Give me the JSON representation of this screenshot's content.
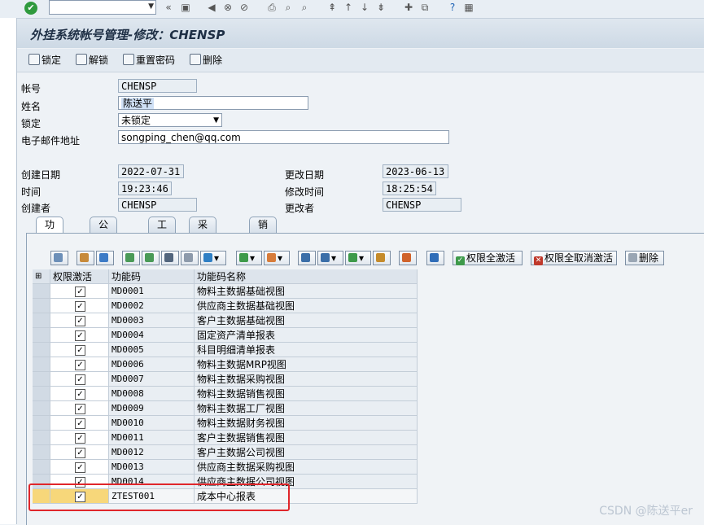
{
  "window": {
    "title": "外挂系统帐号管理-修改：CHENSP"
  },
  "app_toolbar": {
    "lock": "锁定",
    "unlock": "解锁",
    "reset_password": "重置密码",
    "delete": "删除"
  },
  "form": {
    "account_label": "帐号",
    "account_value": "CHENSP",
    "name_label": "姓名",
    "name_value": "陈送平",
    "lock_label": "锁定",
    "lock_value": "未锁定",
    "email_label": "电子邮件地址",
    "email_value": "songping_chen@qq.com",
    "created_date_label": "创建日期",
    "created_date_value": "2022-07-31",
    "changed_date_label": "更改日期",
    "changed_date_value": "2023-06-13",
    "time_label": "时间",
    "time_value": "19:23:46",
    "changed_time_label": "修改时间",
    "changed_time_value": "18:25:54",
    "creator_label": "创建者",
    "creator_value": "CHENSP",
    "changer_label": "更改者",
    "changer_value": "CHENSP"
  },
  "tabs": [
    "功能码",
    "公司代码",
    "工厂",
    "采购组织",
    "销售组织"
  ],
  "grid_toolbar": {
    "activate_all": "权限全激活",
    "deactivate_all": "权限全取消激活",
    "delete": "删除"
  },
  "table": {
    "headers": [
      "权限激活",
      "功能码",
      "功能码名称"
    ],
    "rows": [
      {
        "code": "MD0001",
        "name": "物料主数据基础视图",
        "checked": true
      },
      {
        "code": "MD0002",
        "name": "供应商主数据基础视图",
        "checked": true
      },
      {
        "code": "MD0003",
        "name": "客户主数据基础视图",
        "checked": true
      },
      {
        "code": "MD0004",
        "name": "固定资产清单报表",
        "checked": true
      },
      {
        "code": "MD0005",
        "name": "科目明细清单报表",
        "checked": true
      },
      {
        "code": "MD0006",
        "name": "物料主数据MRP视图",
        "checked": true
      },
      {
        "code": "MD0007",
        "name": "物料主数据采购视图",
        "checked": true
      },
      {
        "code": "MD0008",
        "name": "物料主数据销售视图",
        "checked": true
      },
      {
        "code": "MD0009",
        "name": "物料主数据工厂视图",
        "checked": true
      },
      {
        "code": "MD0010",
        "name": "物料主数据财务视图",
        "checked": true
      },
      {
        "code": "MD0011",
        "name": "客户主数据销售视图",
        "checked": true
      },
      {
        "code": "MD0012",
        "name": "客户主数据公司视图",
        "checked": true
      },
      {
        "code": "MD0013",
        "name": "供应商主数据采购视图",
        "checked": true
      },
      {
        "code": "MD0014",
        "name": "供应商主数据公司视图",
        "checked": true
      },
      {
        "code": "ZTEST001",
        "name": "成本中心报表",
        "checked": true
      }
    ]
  },
  "watermark": "CSDN @陈送平er",
  "colors": {
    "highlight_box": "#e0262b",
    "selected_row": "#f7d77a"
  }
}
